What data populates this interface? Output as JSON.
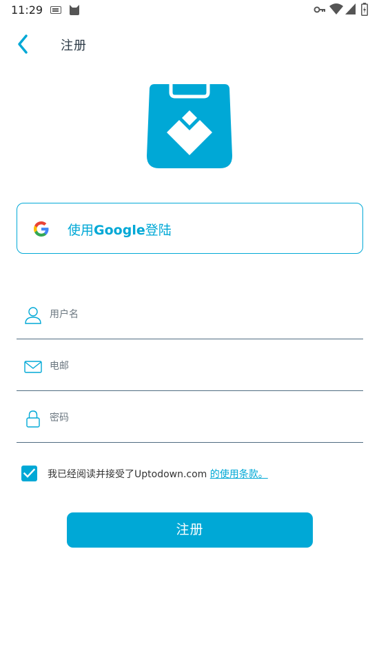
{
  "status_bar": {
    "time": "11:29",
    "icons": [
      "keyboard-icon",
      "cat-icon",
      "vpn-key-icon",
      "wifi-icon",
      "signal-icon",
      "battery-icon"
    ]
  },
  "header": {
    "back_icon": "chevron-left-icon",
    "title": "注册"
  },
  "logo": {
    "name": "uptodown-logo"
  },
  "google_login": {
    "icon": "google-g-icon",
    "label_prefix": "使用",
    "label_brand": "Google",
    "label_suffix": "登陆"
  },
  "form": {
    "username": {
      "icon": "user-icon",
      "placeholder": "用户名",
      "value": ""
    },
    "email": {
      "icon": "mail-icon",
      "placeholder": "电邮",
      "value": ""
    },
    "password": {
      "icon": "lock-icon",
      "placeholder": "密码",
      "value": ""
    }
  },
  "terms": {
    "checked": true,
    "text": "我已经阅读并接受了Uptodown.com ",
    "link_text": "的使用条款。"
  },
  "register_button": {
    "label": "注册"
  },
  "colors": {
    "accent": "#00a8d6",
    "divider": "#4f6b80",
    "title": "#2c3a46"
  }
}
